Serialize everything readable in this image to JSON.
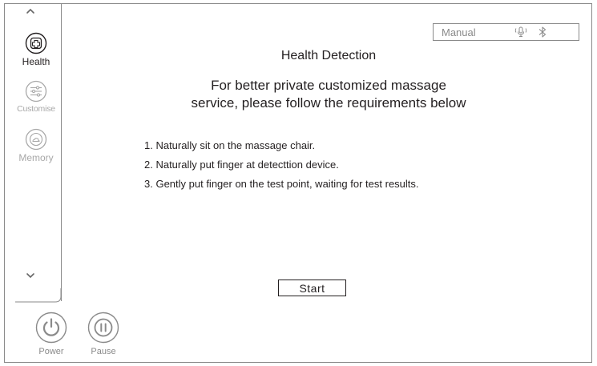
{
  "sidebar": {
    "items": [
      {
        "label": "Health",
        "icon": "health-plus-icon",
        "active": true
      },
      {
        "label": "Customise",
        "icon": "sliders-icon",
        "active": false
      },
      {
        "label": "Memory",
        "icon": "memory-cloud-icon",
        "active": false
      }
    ],
    "scroll_up_icon": "chevron-up-icon",
    "scroll_down_icon": "chevron-down-icon"
  },
  "bottom_controls": {
    "power_label": "Power",
    "pause_label": "Pause",
    "power_icon": "power-icon",
    "pause_icon": "pause-icon"
  },
  "status": {
    "mode": "Manual",
    "voice_icon": "microphone-icon",
    "bluetooth_icon": "bluetooth-icon"
  },
  "main": {
    "title": "Health Detection",
    "subtitle_line1": "For better private customized massage",
    "subtitle_line2": "service, please follow the requirements below",
    "steps": [
      "1. Naturally sit on the massage chair.",
      "2. Naturally put finger at detecttion device.",
      "3. Gently put finger on the test point, waiting for test results."
    ],
    "start_label": "Start"
  },
  "colors": {
    "text": "#231f20",
    "muted": "#a8a8a8",
    "border": "#8a8a8a"
  }
}
